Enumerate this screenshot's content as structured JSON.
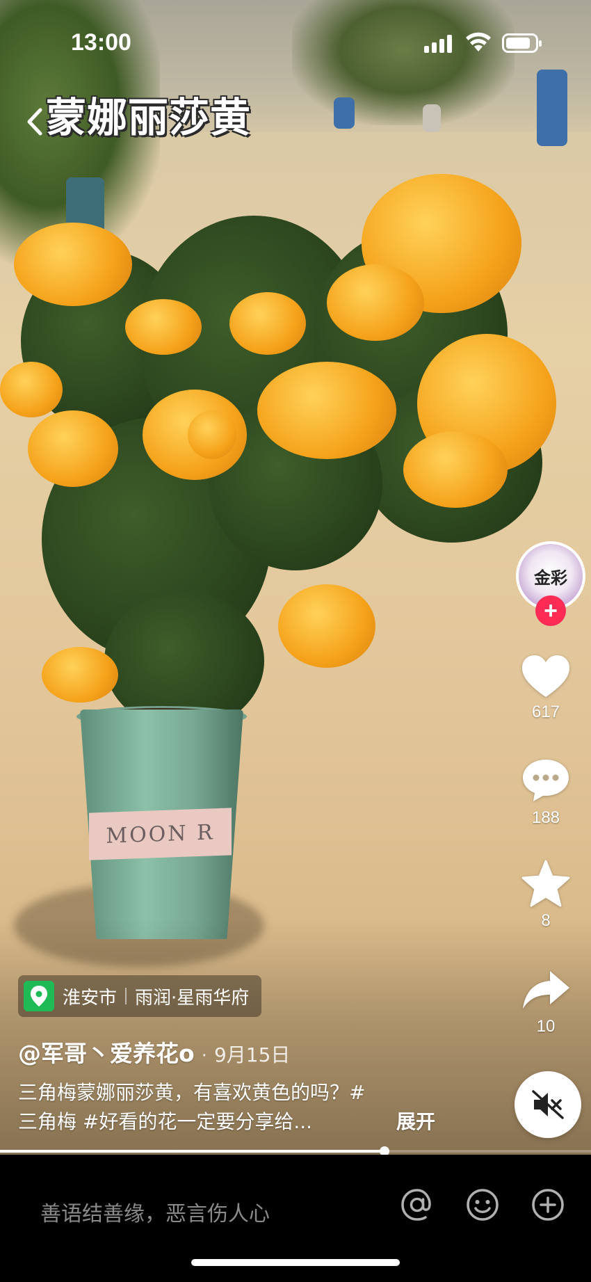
{
  "status_bar": {
    "time": "13:00",
    "battery_level": 0.85
  },
  "video": {
    "title": "蒙娜丽莎黄",
    "pot_text": "MOON R"
  },
  "creator": {
    "avatar_text": "金彩",
    "follow_label": "+"
  },
  "actions": {
    "like_count": "617",
    "comment_count": "188",
    "favorite_count": "8",
    "share_count": "10"
  },
  "location": {
    "city": "淮安市",
    "place": "雨润·星雨华府"
  },
  "post": {
    "author": "@军哥丶爱养花o",
    "date": "9月15日",
    "caption_line1": "三角梅蒙娜丽莎黄，有喜欢黄色的吗？#",
    "caption_line2": "三角梅 #好看的花一定要分享给...",
    "expand_label": "展开"
  },
  "progress": {
    "played_fraction": 0.65
  },
  "comment_bar": {
    "placeholder": "善语结善缘，恶言伤人心"
  },
  "icons": [
    "back-icon",
    "heart-icon",
    "comment-icon",
    "star-icon",
    "share-icon",
    "mute-icon",
    "at-icon",
    "emoji-icon",
    "add-icon",
    "location-icon"
  ],
  "colors": {
    "follow": "#fe2c55",
    "location": "#1fb956",
    "flower": "#f5a21a"
  }
}
